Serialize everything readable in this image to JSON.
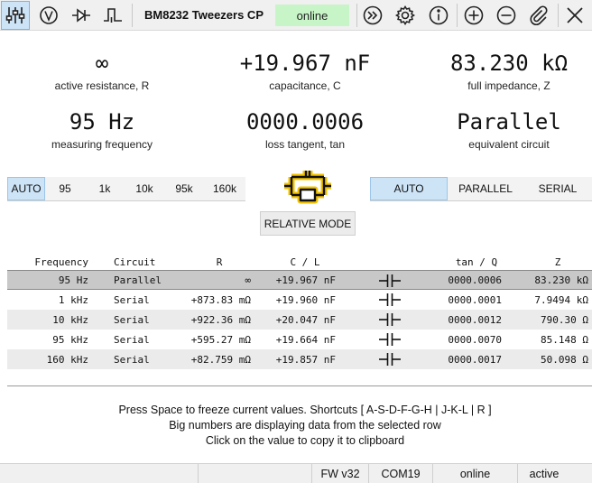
{
  "toolbar": {
    "app_title": "BM8232 Tweezers CP",
    "status": "online",
    "status_color": "#c8f5c8",
    "left_buttons": [
      "tweezers-mode-icon",
      "voltmeter-icon",
      "diode-icon",
      "pulse-icon"
    ],
    "right_buttons": [
      "connect-icon",
      "settings-gear-icon",
      "info-icon",
      "add-icon",
      "remove-icon",
      "attach-icon",
      "close-icon"
    ]
  },
  "readouts": {
    "resistance": {
      "value": "∞",
      "label": "active resistance, R"
    },
    "capacitance": {
      "value": "+19.967 nF",
      "label": "capacitance, C"
    },
    "impedance": {
      "value": "83.230 kΩ",
      "label": "full impedance, Z"
    },
    "frequency": {
      "value": "95 Hz",
      "label": "measuring frequency"
    },
    "loss_tangent": {
      "value": "0000.0006",
      "label": "loss tangent, tan"
    },
    "circuit": {
      "value": "Parallel",
      "label": "equivalent circuit"
    }
  },
  "frequency_options": [
    "AUTO",
    "95",
    "1k",
    "10k",
    "95k",
    "160k"
  ],
  "frequency_selected": "AUTO",
  "circuit_options": [
    "AUTO",
    "PARALLEL",
    "SERIAL"
  ],
  "circuit_selected": "AUTO",
  "relative_mode_label": "RELATIVE MODE",
  "table": {
    "headers": {
      "freq": "Frequency",
      "circuit": "Circuit",
      "r": "R",
      "cl": "C / L",
      "tan": "tan / Q",
      "z": "Z"
    },
    "rows": [
      {
        "freq": "95 Hz",
        "circuit": "Parallel",
        "r": "∞",
        "cl": "+19.967 nF",
        "tan": "0000.0006",
        "z": "83.230 kΩ"
      },
      {
        "freq": "1 kHz",
        "circuit": "Serial",
        "r": "+873.83 mΩ",
        "cl": "+19.960 nF",
        "tan": "0000.0001",
        "z": "7.9494 kΩ"
      },
      {
        "freq": "10 kHz",
        "circuit": "Serial",
        "r": "+922.36 mΩ",
        "cl": "+20.047 nF",
        "tan": "0000.0012",
        "z": "790.30 Ω"
      },
      {
        "freq": "95 kHz",
        "circuit": "Serial",
        "r": "+595.27 mΩ",
        "cl": "+19.664 nF",
        "tan": "0000.0070",
        "z": "85.148 Ω"
      },
      {
        "freq": "160 kHz",
        "circuit": "Serial",
        "r": "+82.759 mΩ",
        "cl": "+19.857 nF",
        "tan": "0000.0017",
        "z": "50.098 Ω"
      }
    ]
  },
  "help": {
    "line1": "Press Space to freeze current values. Shortcuts [ A-S-D-F-G-H | J-K-L | R ]",
    "line2": "Big numbers are displaying data from the selected row",
    "line3": "Click on the value to copy it to clipboard"
  },
  "statusbar": {
    "firmware": "FW v32",
    "port": "COM19",
    "connection": "online",
    "state": "active"
  }
}
